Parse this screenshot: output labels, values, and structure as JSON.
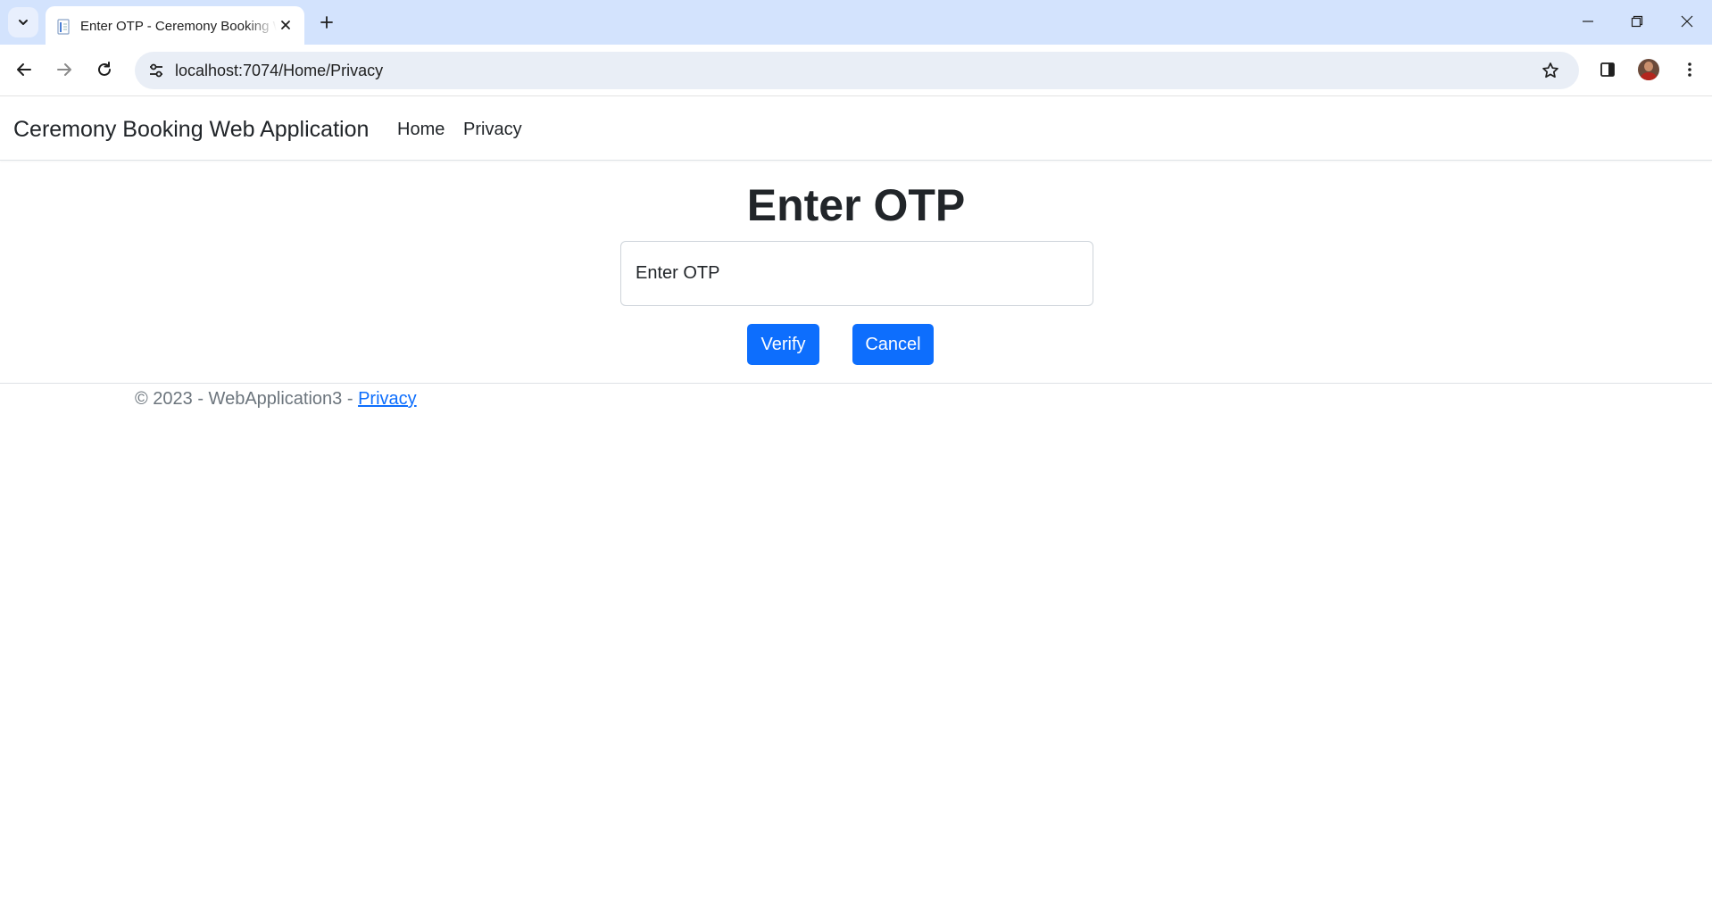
{
  "browser": {
    "tab_title": "Enter OTP - Ceremony Booking Web Application",
    "url": "localhost:7074/Home/Privacy"
  },
  "navbar": {
    "brand": "Ceremony Booking Web Application",
    "links": [
      "Home",
      "Privacy"
    ]
  },
  "main": {
    "heading": "Enter OTP",
    "otp_placeholder": "Enter OTP",
    "verify_label": "Verify",
    "cancel_label": "Cancel"
  },
  "footer": {
    "text": "© 2023 - WebApplication3 - ",
    "link": "Privacy"
  },
  "colors": {
    "primary": "#0d6efd",
    "tabstrip": "#d3e3fd",
    "omnibox": "#e9eef6"
  }
}
